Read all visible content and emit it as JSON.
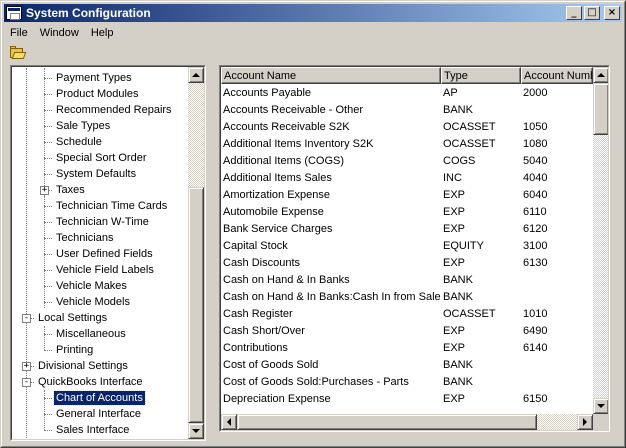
{
  "window": {
    "title": "System Configuration",
    "controls": {
      "minimize": "_",
      "maximize": "□",
      "close": "×"
    }
  },
  "menu": [
    {
      "label": "File"
    },
    {
      "label": "Window"
    },
    {
      "label": "Help"
    }
  ],
  "toolbar": {
    "open_icon": "open-folder-icon"
  },
  "tree": {
    "items": [
      {
        "label": "Payment Types",
        "level": 2,
        "expander": ""
      },
      {
        "label": "Product Modules",
        "level": 2,
        "expander": ""
      },
      {
        "label": "Recommended Repairs",
        "level": 2,
        "expander": ""
      },
      {
        "label": "Sale Types",
        "level": 2,
        "expander": ""
      },
      {
        "label": "Schedule",
        "level": 2,
        "expander": ""
      },
      {
        "label": "Special Sort Order",
        "level": 2,
        "expander": ""
      },
      {
        "label": "System Defaults",
        "level": 2,
        "expander": ""
      },
      {
        "label": "Taxes",
        "level": 2,
        "expander": "+"
      },
      {
        "label": "Technician Time Cards",
        "level": 2,
        "expander": ""
      },
      {
        "label": "Technician W-Time",
        "level": 2,
        "expander": ""
      },
      {
        "label": "Technicians",
        "level": 2,
        "expander": ""
      },
      {
        "label": "User Defined Fields",
        "level": 2,
        "expander": ""
      },
      {
        "label": "Vehicle Field Labels",
        "level": 2,
        "expander": ""
      },
      {
        "label": "Vehicle Makes",
        "level": 2,
        "expander": ""
      },
      {
        "label": "Vehicle Models",
        "level": 2,
        "expander": ""
      },
      {
        "label": "Local Settings",
        "level": 1,
        "expander": "-"
      },
      {
        "label": "Miscellaneous",
        "level": 2,
        "expander": ""
      },
      {
        "label": "Printing",
        "level": 2,
        "expander": ""
      },
      {
        "label": "Divisional Settings",
        "level": 1,
        "expander": "+"
      },
      {
        "label": "QuickBooks Interface",
        "level": 1,
        "expander": "-"
      },
      {
        "label": "Chart of Accounts",
        "level": 2,
        "expander": "",
        "selected": true
      },
      {
        "label": "General Interface",
        "level": 2,
        "expander": ""
      },
      {
        "label": "Sales Interface",
        "level": 2,
        "expander": ""
      }
    ]
  },
  "accounts": {
    "columns": [
      "Account Name",
      "Type",
      "Account Number"
    ],
    "rows": [
      [
        "Accounts Payable",
        "AP",
        "2000"
      ],
      [
        "Accounts Receivable - Other",
        "BANK",
        ""
      ],
      [
        "Accounts Receivable S2K",
        "OCASSET",
        "1050"
      ],
      [
        "Additional  Items Inventory S2K",
        "OCASSET",
        "1080"
      ],
      [
        "Additional Items (COGS)",
        "COGS",
        "5040"
      ],
      [
        "Additional Items Sales",
        "INC",
        "4040"
      ],
      [
        "Amortization Expense",
        "EXP",
        "6040"
      ],
      [
        "Automobile Expense",
        "EXP",
        "6110"
      ],
      [
        "Bank Service Charges",
        "EXP",
        "6120"
      ],
      [
        "Capital Stock",
        "EQUITY",
        "3100"
      ],
      [
        "Cash Discounts",
        "EXP",
        "6130"
      ],
      [
        "Cash on Hand & In Banks",
        "BANK",
        ""
      ],
      [
        "Cash on Hand & In Banks:Cash In from Sales",
        "BANK",
        ""
      ],
      [
        "Cash Register",
        "OCASSET",
        "1010"
      ],
      [
        "Cash Short/Over",
        "EXP",
        "6490"
      ],
      [
        "Contributions",
        "EXP",
        "6140"
      ],
      [
        "Cost of Goods Sold",
        "BANK",
        ""
      ],
      [
        "Cost of Goods Sold:Purchases - Parts",
        "BANK",
        ""
      ],
      [
        "Depreciation Expense",
        "EXP",
        "6150"
      ]
    ]
  }
}
